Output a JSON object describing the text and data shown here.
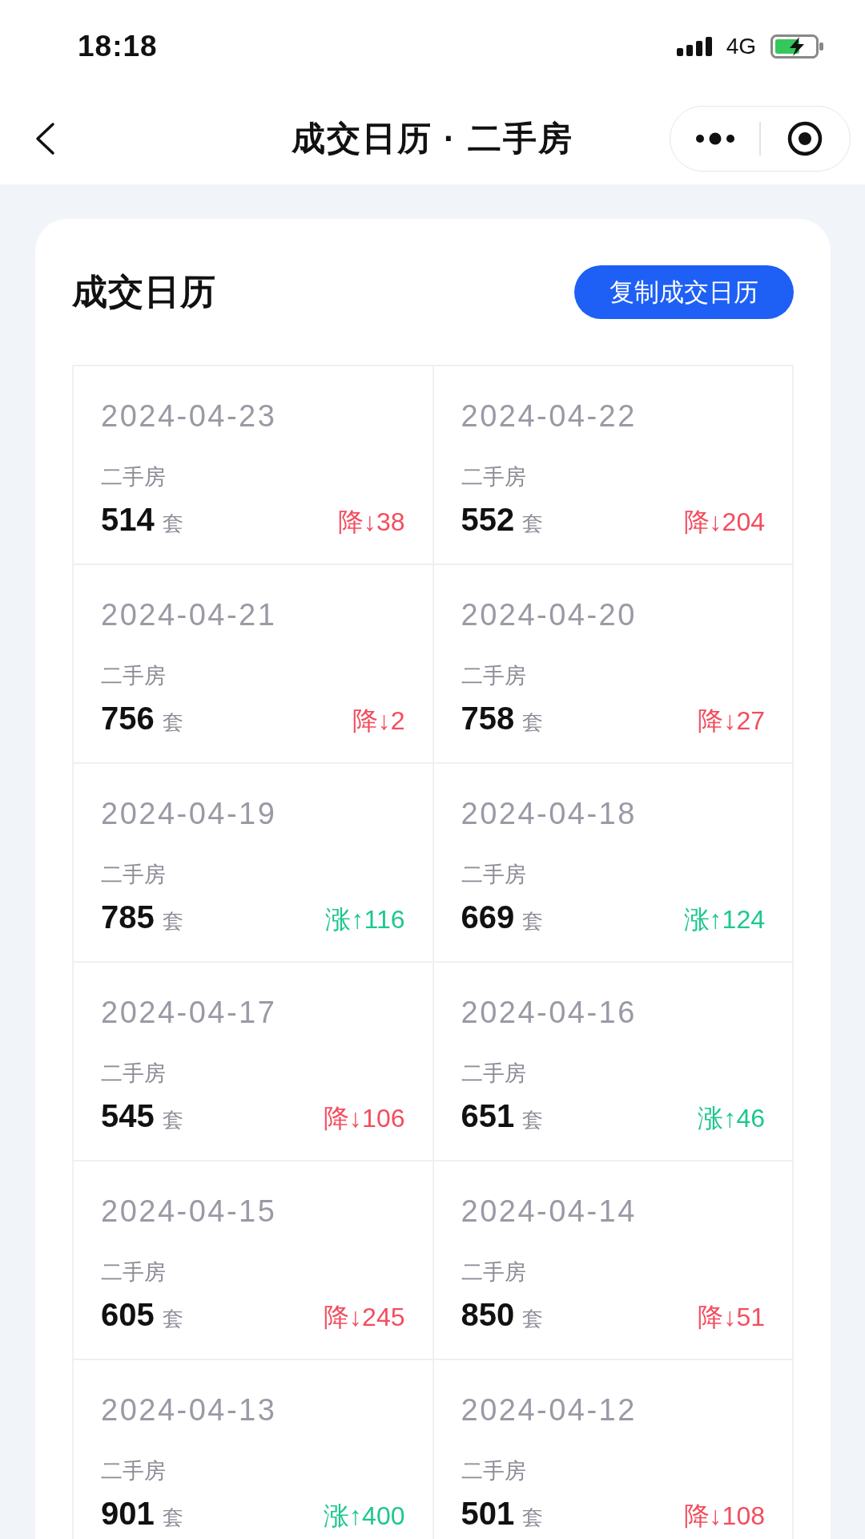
{
  "status_bar": {
    "time": "18:18",
    "network": "4G"
  },
  "nav_bar": {
    "title": "成交日历 · 二手房"
  },
  "card": {
    "title": "成交日历",
    "copy_button": "复制成交日历",
    "days": [
      {
        "date": "2024-04-23",
        "category": "二手房",
        "count": "514",
        "unit": "套",
        "change": "降↓38",
        "color": "#f34d5e"
      },
      {
        "date": "2024-04-22",
        "category": "二手房",
        "count": "552",
        "unit": "套",
        "change": "降↓204",
        "color": "#f34d5e"
      },
      {
        "date": "2024-04-21",
        "category": "二手房",
        "count": "756",
        "unit": "套",
        "change": "降↓2",
        "color": "#f34d5e"
      },
      {
        "date": "2024-04-20",
        "category": "二手房",
        "count": "758",
        "unit": "套",
        "change": "降↓27",
        "color": "#f34d5e"
      },
      {
        "date": "2024-04-19",
        "category": "二手房",
        "count": "785",
        "unit": "套",
        "change": "涨↑116",
        "color": "#1fc78e"
      },
      {
        "date": "2024-04-18",
        "category": "二手房",
        "count": "669",
        "unit": "套",
        "change": "涨↑124",
        "color": "#1fc78e"
      },
      {
        "date": "2024-04-17",
        "category": "二手房",
        "count": "545",
        "unit": "套",
        "change": "降↓106",
        "color": "#f34d5e"
      },
      {
        "date": "2024-04-16",
        "category": "二手房",
        "count": "651",
        "unit": "套",
        "change": "涨↑46",
        "color": "#1fc78e"
      },
      {
        "date": "2024-04-15",
        "category": "二手房",
        "count": "605",
        "unit": "套",
        "change": "降↓245",
        "color": "#f34d5e"
      },
      {
        "date": "2024-04-14",
        "category": "二手房",
        "count": "850",
        "unit": "套",
        "change": "降↓51",
        "color": "#f34d5e"
      },
      {
        "date": "2024-04-13",
        "category": "二手房",
        "count": "901",
        "unit": "套",
        "change": "涨↑400",
        "color": "#1fc78e"
      },
      {
        "date": "2024-04-12",
        "category": "二手房",
        "count": "501",
        "unit": "套",
        "change": "降↓108",
        "color": "#f34d5e"
      }
    ]
  }
}
